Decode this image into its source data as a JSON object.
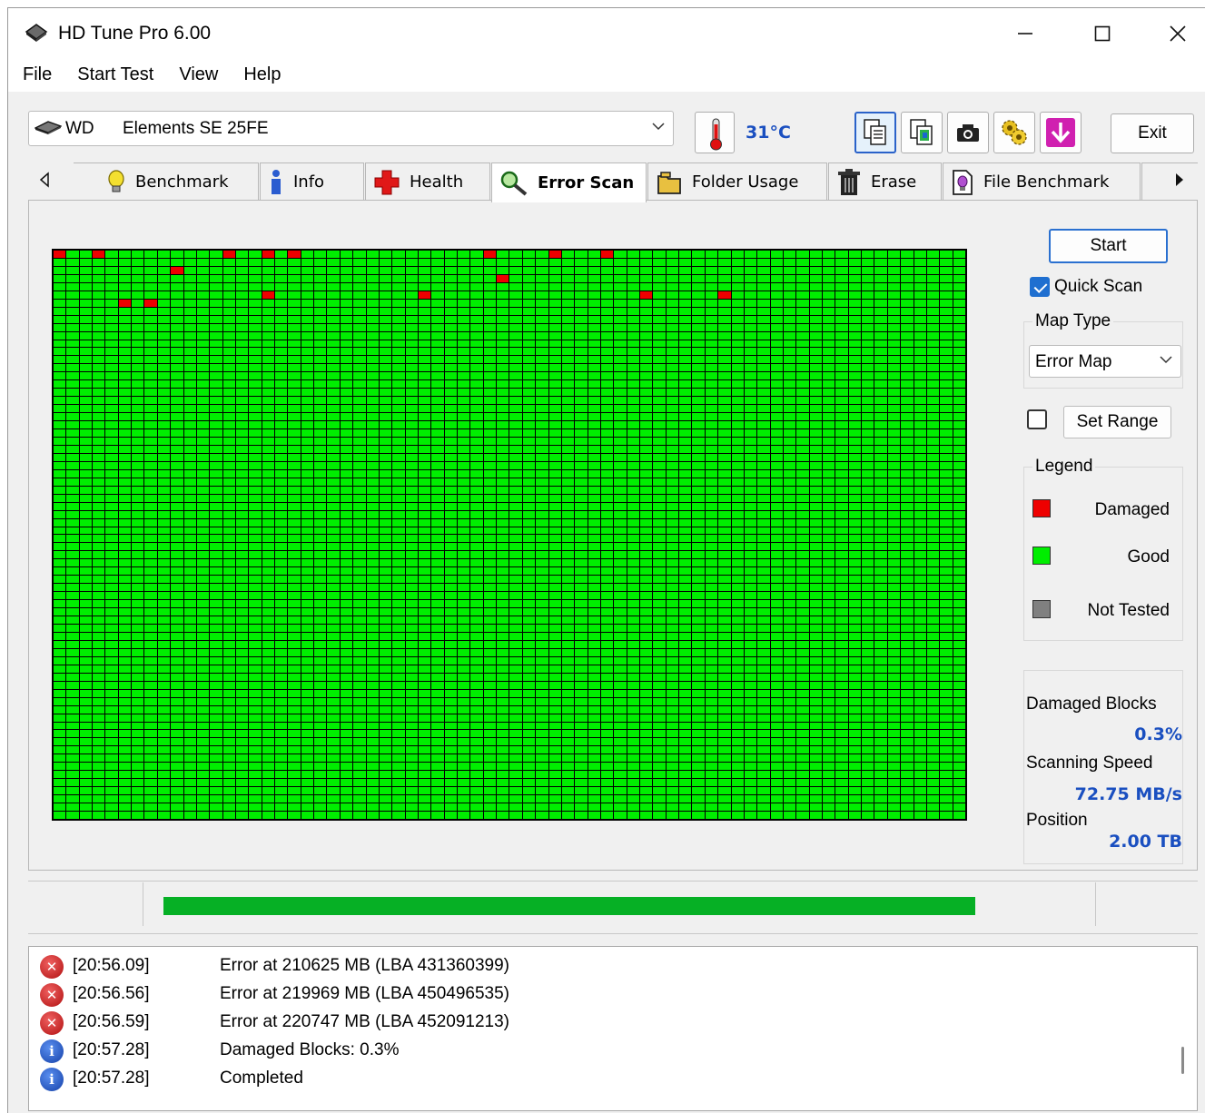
{
  "window": {
    "title": "HD Tune Pro 6.00"
  },
  "menu": [
    "File",
    "Start Test",
    "View",
    "Help"
  ],
  "drive": {
    "vendor": "WD",
    "model": "Elements SE 25FE"
  },
  "temperature": "31°C",
  "toolbar": {
    "exit_label": "Exit"
  },
  "tabs": [
    {
      "label": "Benchmark",
      "icon": "lightbulb-icon"
    },
    {
      "label": "Info",
      "icon": "info-icon"
    },
    {
      "label": "Health",
      "icon": "health-cross-icon"
    },
    {
      "label": "Error Scan",
      "icon": "magnifier-icon",
      "active": true
    },
    {
      "label": "Folder Usage",
      "icon": "folder-icon"
    },
    {
      "label": "Erase",
      "icon": "trash-icon"
    },
    {
      "label": "File Benchmark",
      "icon": "file-benchmark-icon"
    }
  ],
  "scan": {
    "start_label": "Start",
    "quick_scan_label": "Quick Scan",
    "quick_scan_checked": true,
    "map_type_title": "Map Type",
    "map_type_value": "Error Map",
    "set_range_label": "Set Range",
    "set_range_checked": false,
    "legend_title": "Legend",
    "legend": [
      {
        "label": "Damaged",
        "color": "#ee0000"
      },
      {
        "label": "Good",
        "color": "#00ee00"
      },
      {
        "label": "Not Tested",
        "color": "#808080"
      }
    ],
    "stats": {
      "damaged_label": "Damaged Blocks",
      "damaged_value": "0.3%",
      "speed_label": "Scanning Speed",
      "speed_value": "72.75 MB/s",
      "position_label": "Position",
      "position_value": "2.00 TB"
    },
    "grid": {
      "columns": 70,
      "rows": 70,
      "damaged_cells": [
        [
          0,
          0
        ],
        [
          0,
          3
        ],
        [
          0,
          13
        ],
        [
          0,
          16
        ],
        [
          0,
          18
        ],
        [
          0,
          33
        ],
        [
          0,
          38
        ],
        [
          0,
          42
        ],
        [
          2,
          9
        ],
        [
          3,
          34
        ],
        [
          5,
          16
        ],
        [
          5,
          28
        ],
        [
          5,
          45
        ],
        [
          5,
          51
        ],
        [
          6,
          5
        ],
        [
          6,
          7
        ]
      ]
    }
  },
  "progress": {
    "fraction": 1.0
  },
  "log": [
    {
      "type": "error",
      "time": "[20:56.09]",
      "message": "Error at 210625 MB (LBA 431360399)"
    },
    {
      "type": "error",
      "time": "[20:56.56]",
      "message": "Error at 219969 MB (LBA 450496535)"
    },
    {
      "type": "error",
      "time": "[20:56.59]",
      "message": "Error at 220747 MB (LBA 452091213)"
    },
    {
      "type": "info",
      "time": "[20:57.28]",
      "message": "Damaged Blocks: 0.3%"
    },
    {
      "type": "info",
      "time": "[20:57.28]",
      "message": "Completed"
    }
  ]
}
